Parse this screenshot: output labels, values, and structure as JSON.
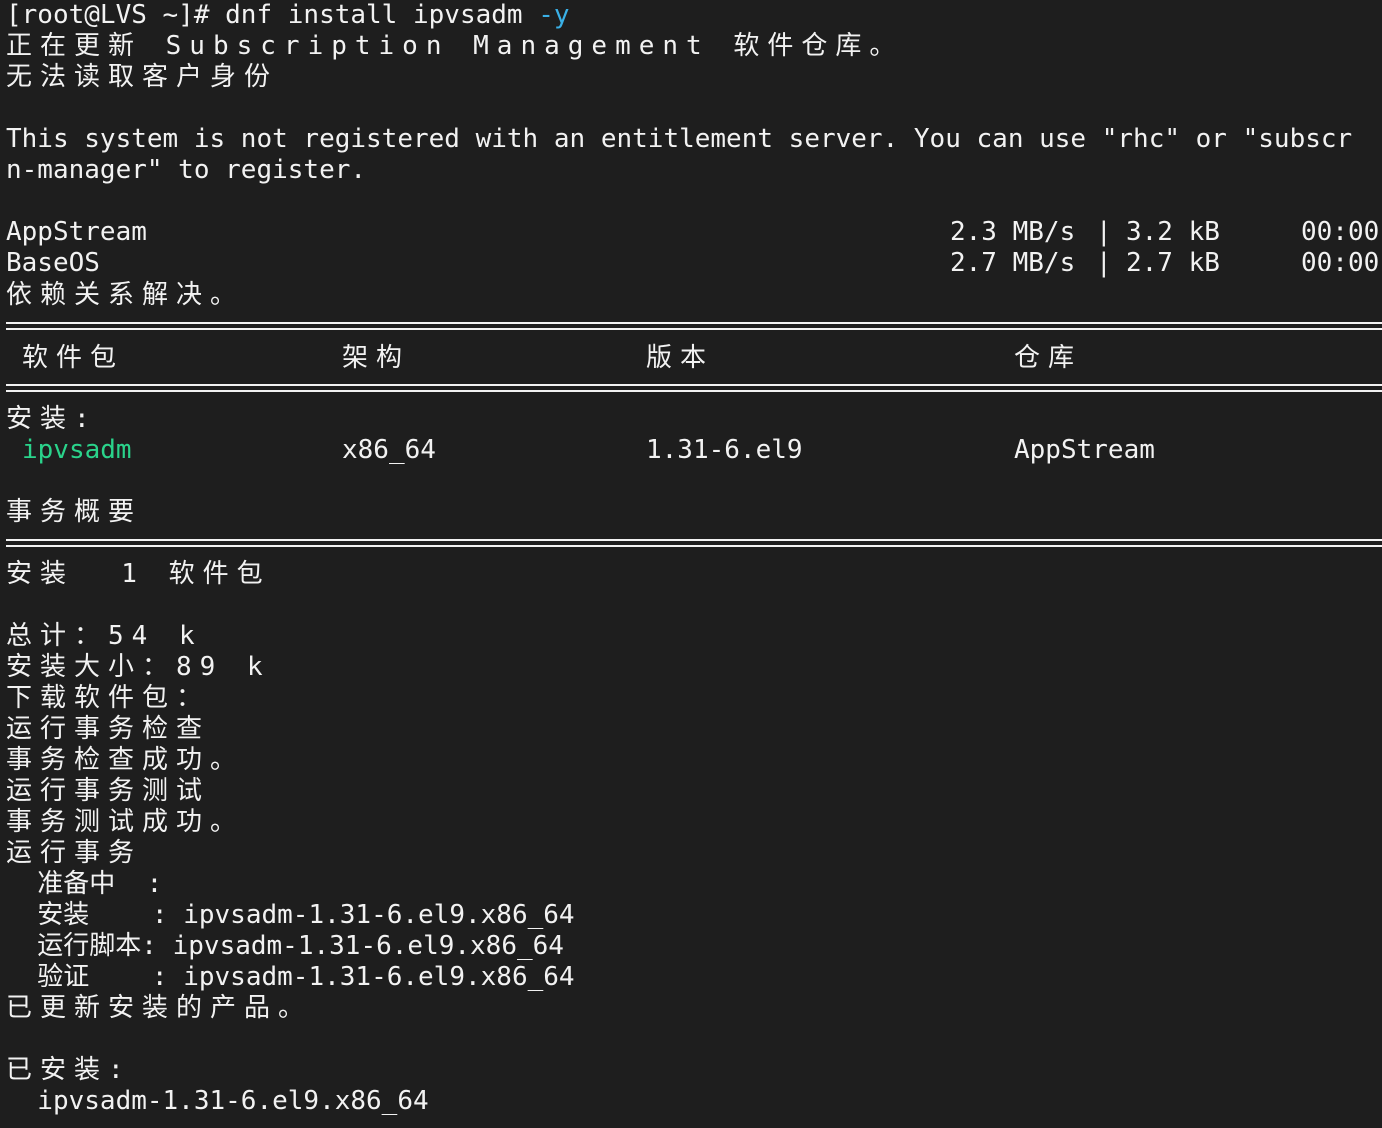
{
  "prompt": {
    "text": "[root@LVS ~]# dnf install ipvsadm ",
    "flag": "-y"
  },
  "lines": {
    "updating": "正在更新 Subscription Management 软件仓库。",
    "no_identity": "无法读取客户身份",
    "not_registered_1": "This system is not registered with an entitlement server. You can use \"rhc\" or \"subscr",
    "not_registered_2": "n-manager\" to register.",
    "resolving": "依赖关系解决。",
    "install_heading": "安装:",
    "summary_heading": "事务概要",
    "install_count": "安装  1 软件包",
    "total": "总计：54 k",
    "install_size": "安装大小：89 k",
    "downloading": "下载软件包：",
    "running_check": "运行事务检查",
    "check_ok": "事务检查成功。",
    "running_test": "运行事务测试",
    "test_ok": "事务测试成功。",
    "running_tx": "运行事务",
    "preparing": "  准备中  :",
    "installing": "  安装    : ipvsadm-1.31-6.el9.x86_64",
    "scriptlet": "  运行脚本: ipvsadm-1.31-6.el9.x86_64",
    "verifying": "  验证    : ipvsadm-1.31-6.el9.x86_64",
    "updated": "已更新安装的产品。",
    "installed_heading": "已安装:",
    "installed_pkg": "  ipvsadm-1.31-6.el9.x86_64"
  },
  "repos": [
    {
      "name": "AppStream",
      "speed": "2.3 MB/s",
      "size": "3.2 kB",
      "time": "00:00"
    },
    {
      "name": "BaseOS",
      "speed": "2.7 MB/s",
      "size": "2.7 kB",
      "time": "00:00"
    }
  ],
  "table": {
    "headers": {
      "package": "软件包",
      "arch": "架构",
      "version": "版本",
      "repo": "仓库"
    },
    "row": {
      "package": "ipvsadm",
      "arch": "x86_64",
      "version": "1.31-6.el9",
      "repo": "AppStream"
    }
  },
  "colors": {
    "background": "#1e1e1e",
    "foreground": "#f2f2f2",
    "package_green": "#2ad38b",
    "flag_blue": "#3ab0e6"
  }
}
